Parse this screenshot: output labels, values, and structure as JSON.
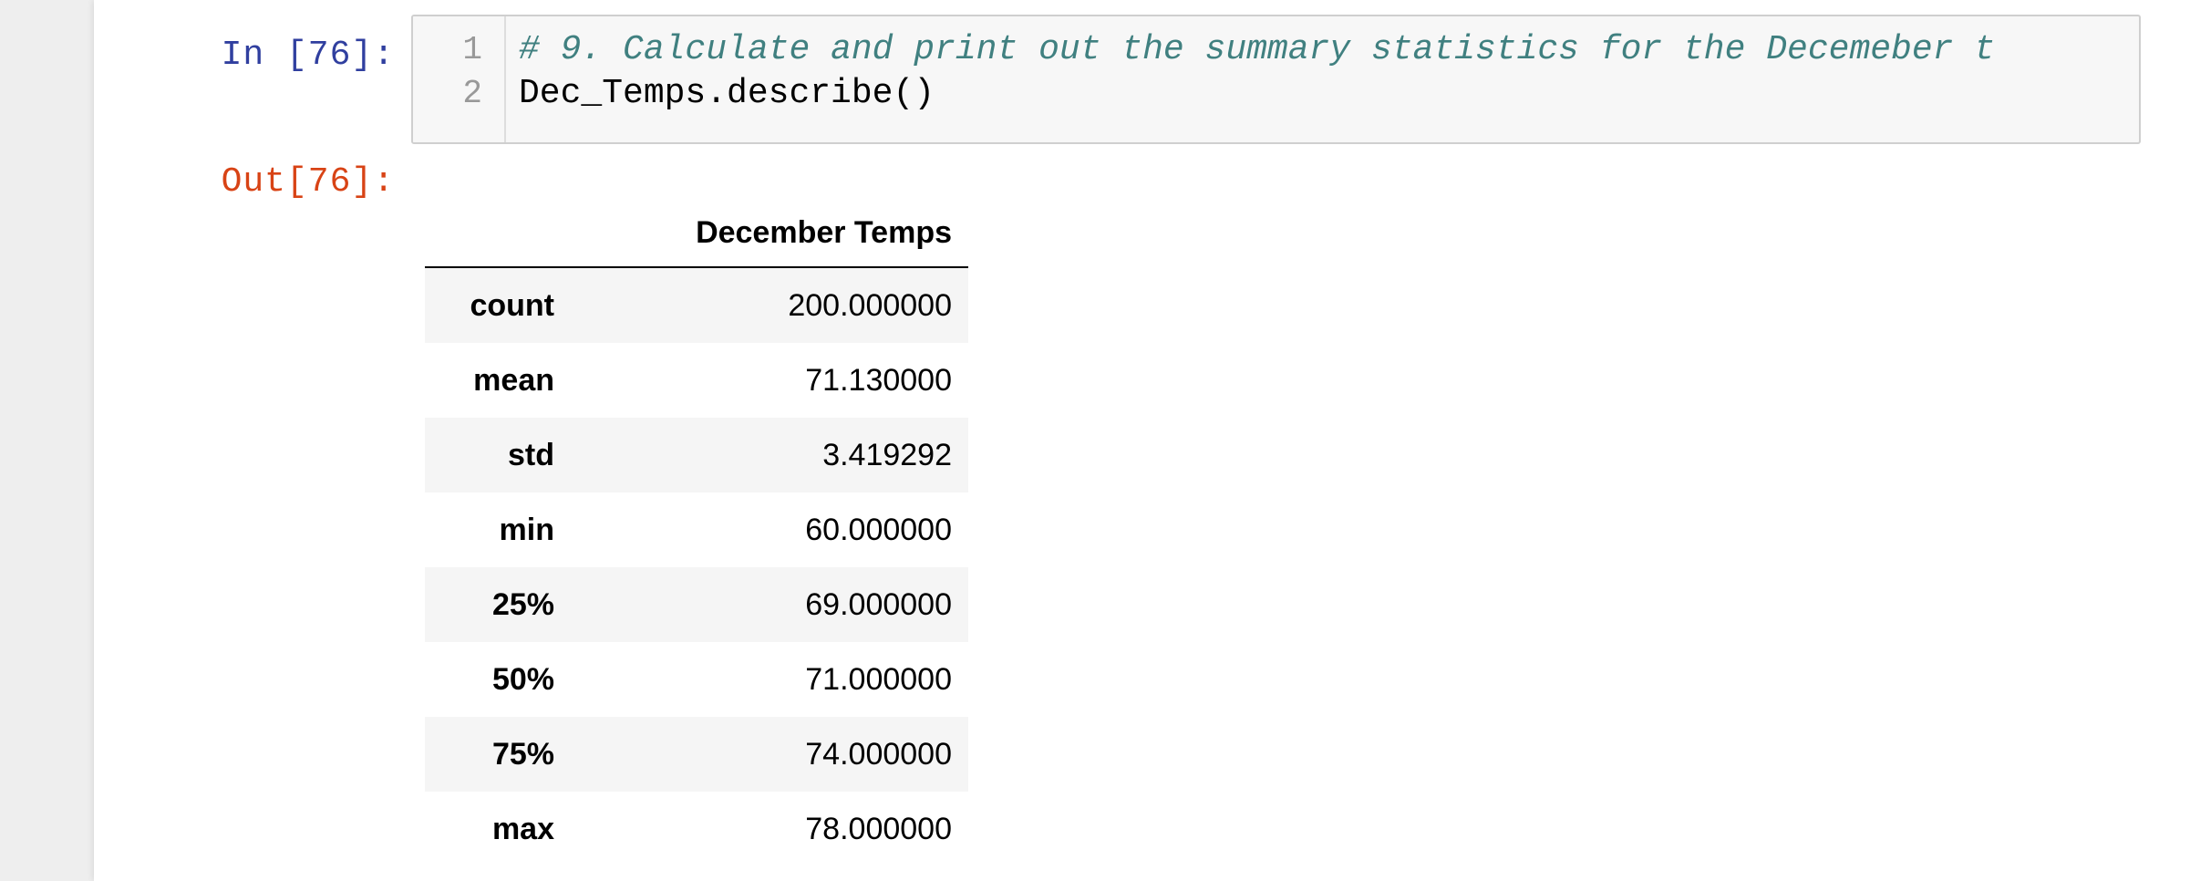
{
  "input_cell": {
    "prompt": "In [76]:",
    "line_numbers": [
      "1",
      "2"
    ],
    "lines": [
      "# 9. Calculate and print out the summary statistics for the Decemeber t",
      "Dec_Temps.describe()"
    ]
  },
  "output_cell": {
    "prompt": "Out[76]:",
    "table": {
      "column_header": "December Temps",
      "rows": [
        {
          "label": "count",
          "value": "200.000000"
        },
        {
          "label": "mean",
          "value": "71.130000"
        },
        {
          "label": "std",
          "value": "3.419292"
        },
        {
          "label": "min",
          "value": "60.000000"
        },
        {
          "label": "25%",
          "value": "69.000000"
        },
        {
          "label": "50%",
          "value": "71.000000"
        },
        {
          "label": "75%",
          "value": "74.000000"
        },
        {
          "label": "max",
          "value": "78.000000"
        }
      ]
    }
  },
  "colors": {
    "in_prompt": "#303f9f",
    "out_prompt": "#d84315",
    "comment": "#408080",
    "row_stripe": "#f5f5f5"
  }
}
